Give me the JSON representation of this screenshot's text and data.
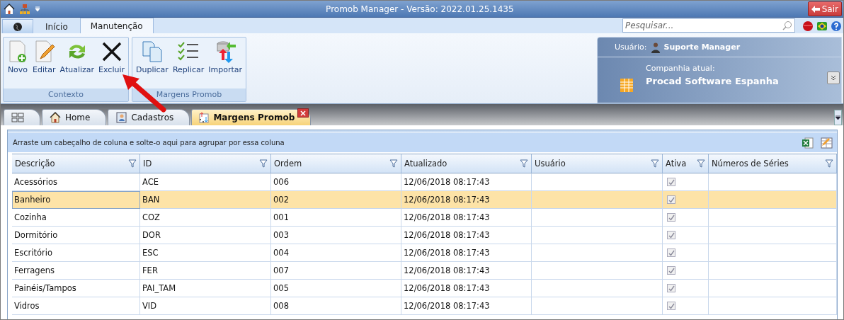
{
  "window": {
    "title": "Promob Manager - Versão: 2022.01.25.1435",
    "exit_button": "Sair"
  },
  "ribbon_tabs": [
    {
      "label": "Início",
      "selected": false
    },
    {
      "label": "Manutenção",
      "selected": true
    }
  ],
  "search": {
    "placeholder": "Pesquisar..."
  },
  "ribbon_groups": [
    {
      "title": "Contexto",
      "buttons": [
        {
          "kind": "new",
          "label": "Novo"
        },
        {
          "kind": "edit",
          "label": "Editar"
        },
        {
          "kind": "refresh",
          "label": "Atualizar"
        },
        {
          "kind": "delete",
          "label": "Excluir"
        }
      ]
    },
    {
      "title": "Margens Promob",
      "buttons": [
        {
          "kind": "duplicate",
          "label": "Duplicar"
        },
        {
          "kind": "replicate",
          "label": "Replicar"
        },
        {
          "kind": "import",
          "label": "Importar"
        }
      ]
    }
  ],
  "user_panel": {
    "user_label": "Usuário:",
    "user_name": "Suporte Manager",
    "company_label": "Companhia atual:",
    "company_name": "Procad Software Espanha"
  },
  "doc_tabs": [
    {
      "kind": "overview",
      "selected": false
    },
    {
      "kind": "home",
      "label": "Home",
      "selected": false
    },
    {
      "kind": "registry",
      "label": "Cadastros",
      "selected": false
    },
    {
      "kind": "margins",
      "label": "Margens Promob",
      "selected": true
    }
  ],
  "grid": {
    "group_hint": "Arraste um cabeçalho de coluna e solte-o aqui para agrupar por essa coluna",
    "columns": [
      "Descrição",
      "ID",
      "Ordem",
      "Atualizado",
      "Usuário",
      "Ativa",
      "Números de Séries"
    ],
    "rows": [
      {
        "descricao": "Acessórios",
        "id": "ACE",
        "ordem": "006",
        "atualizado": "12/06/2018 08:17:43",
        "ativa": true,
        "selected": false
      },
      {
        "descricao": "Banheiro",
        "id": "BAN",
        "ordem": "002",
        "atualizado": "12/06/2018 08:17:43",
        "ativa": true,
        "selected": true
      },
      {
        "descricao": "Cozinha",
        "id": "COZ",
        "ordem": "001",
        "atualizado": "12/06/2018 08:17:43",
        "ativa": true,
        "selected": false
      },
      {
        "descricao": "Dormitório",
        "id": "DOR",
        "ordem": "003",
        "atualizado": "12/06/2018 08:17:43",
        "ativa": true,
        "selected": false
      },
      {
        "descricao": "Escritório",
        "id": "ESC",
        "ordem": "004",
        "atualizado": "12/06/2018 08:17:43",
        "ativa": true,
        "selected": false
      },
      {
        "descricao": "Ferragens",
        "id": "FER",
        "ordem": "007",
        "atualizado": "12/06/2018 08:17:43",
        "ativa": true,
        "selected": false
      },
      {
        "descricao": "Painéis/Tampos",
        "id": "PAI_TAM",
        "ordem": "005",
        "atualizado": "12/06/2018 08:17:43",
        "ativa": true,
        "selected": false
      },
      {
        "descricao": "Vidros",
        "id": "VID",
        "ordem": "008",
        "atualizado": "12/06/2018 08:17:43",
        "ativa": true,
        "selected": false
      }
    ]
  }
}
